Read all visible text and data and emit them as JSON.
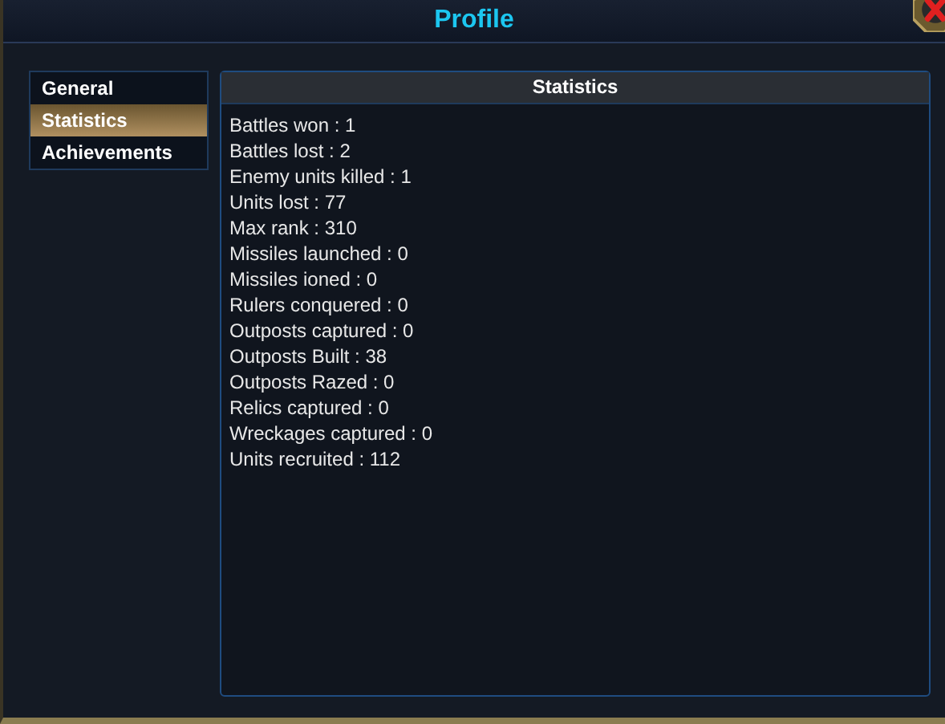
{
  "window": {
    "title": "Profile"
  },
  "menu": [
    {
      "label": "General",
      "selected": false
    },
    {
      "label": "Statistics",
      "selected": true
    },
    {
      "label": "Achievements",
      "selected": false
    }
  ],
  "panel": {
    "title": "Statistics",
    "lines": [
      "Battles won : 1",
      "Battles lost : 2",
      "Enemy units killed : 1",
      "Units lost : 77",
      "Max rank : 310",
      "Missiles launched : 0",
      "Missiles ioned : 0",
      "Rulers conquered : 0",
      "Outposts captured : 0",
      "Outposts Built : 38",
      "Outposts Razed : 0",
      "Relics captured : 0",
      "Wreckages captured : 0",
      "Units recruited : 112"
    ]
  }
}
